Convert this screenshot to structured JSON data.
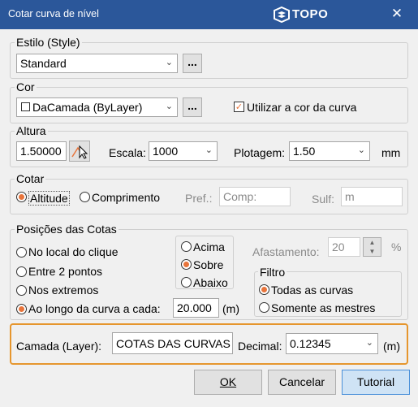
{
  "window": {
    "title": "Cotar curva de nível",
    "logo_text": "TOPO",
    "close_glyph": "✕"
  },
  "estilo": {
    "legend": "Estilo (Style)",
    "value": "Standard",
    "browse_label": "..."
  },
  "cor": {
    "legend": "Cor",
    "value": "DaCamada (ByLayer)",
    "browse_label": "...",
    "use_curve_color_label": "Utilizar a cor da curva",
    "use_curve_color_checked": true
  },
  "altura": {
    "legend": "Altura",
    "value": "1.50000",
    "escala_label": "Escala:",
    "escala_value": "1000",
    "plotagem_label": "Plotagem:",
    "plotagem_value": "1.50",
    "unit": "mm"
  },
  "cotar": {
    "legend": "Cotar",
    "altitude_label": "Altitude",
    "comprimento_label": "Comprimento",
    "pref_label": "Pref.:",
    "pref_placeholder": "Comp:",
    "sulf_label": "Sulf:",
    "sulf_placeholder": "m"
  },
  "posicoes": {
    "legend": "Posições das Cotas",
    "options": [
      "No local do clique",
      "Entre 2 pontos",
      "Nos extremos",
      "Ao longo da curva a cada:"
    ],
    "interval_value": "20.000",
    "interval_unit": "(m)",
    "vertical": [
      "Acima",
      "Sobre",
      "Abaixo"
    ],
    "afastamento_label": "Afastamento:",
    "afastamento_value": "20",
    "afastamento_unit": "%",
    "filtro_legend": "Filtro",
    "filtro_options": [
      "Todas as curvas",
      "Somente as mestres"
    ]
  },
  "camada": {
    "label": "Camada (Layer):",
    "value": "COTAS DAS CURVAS",
    "decimal_label": "Decimal:",
    "decimal_value": "0.12345",
    "unit": "(m)"
  },
  "buttons": {
    "ok": "OK",
    "cancel": "Cancelar",
    "tutorial": "Tutorial"
  },
  "colors": {
    "titlebar": "#2b579a",
    "accent": "#e8743b",
    "highlight_border": "#e6962e",
    "tutorial_bg": "#cfe3f5",
    "tutorial_border": "#4a90d9"
  }
}
